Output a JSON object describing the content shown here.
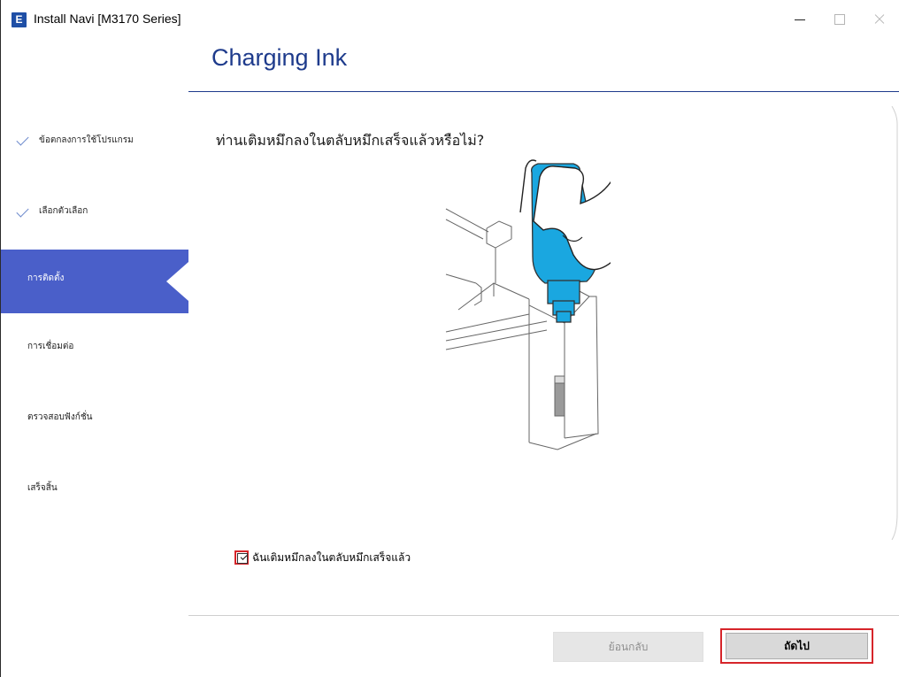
{
  "window": {
    "title": "Install Navi [M3170 Series]",
    "app_icon_glyph": "E"
  },
  "page": {
    "title": "Charging Ink"
  },
  "steps": [
    {
      "label": "ข้อตกลงการใช้โปรแกรม",
      "state": "done"
    },
    {
      "label": "เลือกตัวเลือก",
      "state": "done"
    },
    {
      "label": "การติดตั้ง",
      "state": "active"
    },
    {
      "label": "การเชื่อมต่อ",
      "state": "pending"
    },
    {
      "label": "ตรวจสอบฟังก์ชั่น",
      "state": "pending"
    },
    {
      "label": "เสร็จสิ้น",
      "state": "pending"
    }
  ],
  "content": {
    "question": "ท่านเติมหมึกลงในตลับหมึกเสร็จแล้วหรือไม่?",
    "confirm_label": "ฉันเติมหมึกลงในตลับหมึกเสร็จแล้ว",
    "confirm_checked": true,
    "illustration_icon": "ink-bottle-refill-illustration"
  },
  "footer": {
    "back_label": "ย้อนกลับ",
    "back_enabled": false,
    "next_label": "ถัดไป"
  },
  "colors": {
    "accent": "#1e3b8c",
    "active_step": "#4a5fc9",
    "ink": "#1aa7e0",
    "highlight": "#d6252a"
  }
}
